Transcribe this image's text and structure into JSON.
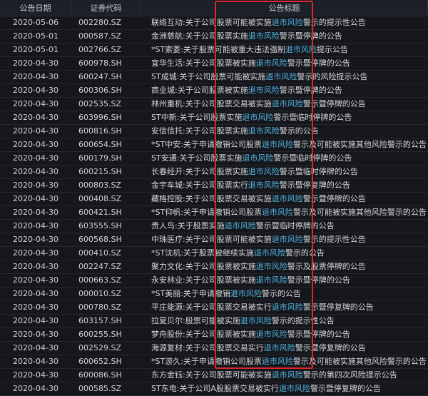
{
  "table": {
    "columns": {
      "date": "公告日期",
      "code": "证券代码",
      "title": "公告标题"
    },
    "rows": [
      {
        "date": "2020-05-06",
        "code": "002280.SZ",
        "pre": "联络互动:关于公司股票可能被实施",
        "hl": "退市风险",
        "post": "警示的提示性公告"
      },
      {
        "date": "2020-05-01",
        "code": "000587.SZ",
        "pre": "金洲慈航:关于公司股票实施",
        "hl": "退市风险",
        "post": "警示暨停牌的公告"
      },
      {
        "date": "2020-05-01",
        "code": "002766.SZ",
        "pre": "*ST索菱:关于股票可能被重大违法强制",
        "hl": "退市风险",
        "post": "提示公告"
      },
      {
        "date": "2020-04-30",
        "code": "600978.SH",
        "pre": "宜华生活:关于公司股票被实施",
        "hl": "退市风险",
        "post": "警示暨停牌的公告"
      },
      {
        "date": "2020-04-30",
        "code": "600247.SH",
        "pre": "ST成城:关于公司股票可能被实施",
        "hl": "退市风险",
        "post": "警示的风险提示公告"
      },
      {
        "date": "2020-04-30",
        "code": "600306.SH",
        "pre": "商业城:关于公司股票被实施",
        "hl": "退市风险",
        "post": "警示暨停牌的公告"
      },
      {
        "date": "2020-04-30",
        "code": "002535.SZ",
        "pre": "林州重机:关于公司股票交易被实施",
        "hl": "退市风险",
        "post": "警示暨停牌的公告"
      },
      {
        "date": "2020-04-30",
        "code": "603996.SH",
        "pre": "ST中新:关于公司股票实施",
        "hl": "退市风险",
        "post": "警示暨临时停牌的公告"
      },
      {
        "date": "2020-04-30",
        "code": "600816.SH",
        "pre": "安信信托:关于公司股票实施",
        "hl": "退市风险",
        "post": "警示的公告"
      },
      {
        "date": "2020-04-30",
        "code": "600654.SH",
        "pre": "*ST中安:关于申请撤销公司股票",
        "hl": "退市风险",
        "post": "警示及可能被实施其他风险警示的公告"
      },
      {
        "date": "2020-04-30",
        "code": "600179.SH",
        "pre": "ST安通:关于公司股票实施",
        "hl": "退市风险",
        "post": "警示暨临时停牌的公告"
      },
      {
        "date": "2020-04-30",
        "code": "600215.SH",
        "pre": "长春经开:关于公司股票实施",
        "hl": "退市风险",
        "post": "警示暨临时停牌的公告"
      },
      {
        "date": "2020-04-30",
        "code": "000803.SZ",
        "pre": "金宇车城:关于公司股票实行",
        "hl": "退市风险",
        "post": "警示暨停复牌的公告"
      },
      {
        "date": "2020-04-30",
        "code": "000408.SZ",
        "pre": "藏格控股:关于公司股票交易被实施",
        "hl": "退市风险",
        "post": "警示暨停牌的公告"
      },
      {
        "date": "2020-04-30",
        "code": "600421.SH",
        "pre": "*ST仰帆:关于申请撤销公司股票",
        "hl": "退市风险",
        "post": "警示及可能被实施其他风险警示的公告"
      },
      {
        "date": "2020-04-30",
        "code": "603555.SH",
        "pre": "贵人鸟:关于股票实施",
        "hl": "退市风险",
        "post": "警示暨临时停牌的公告"
      },
      {
        "date": "2020-04-30",
        "code": "600568.SH",
        "pre": "中珠医疗:关于公司股票可能被实施",
        "hl": "退市风险",
        "post": "警示的提示性公告"
      },
      {
        "date": "2020-04-30",
        "code": "000410.SZ",
        "pre": "*ST沈机:关于股票被继续实施",
        "hl": "退市风险",
        "post": "警示的公告"
      },
      {
        "date": "2020-04-30",
        "code": "002247.SZ",
        "pre": "聚力文化:关于公司股票被实施",
        "hl": "退市风险",
        "post": "警示及股票停牌的公告"
      },
      {
        "date": "2020-04-30",
        "code": "000663.SZ",
        "pre": "永安林业:关于公司股票被实施",
        "hl": "退市风险",
        "post": "警示暨停牌的公告"
      },
      {
        "date": "2020-04-30",
        "code": "000010.SZ",
        "pre": "*ST美丽:关于申请撤销",
        "hl": "退市风险",
        "post": "警示的公告"
      },
      {
        "date": "2020-04-30",
        "code": "000780.SZ",
        "pre": "平庄能源:关于公司股票交易被实行",
        "hl": "退市风险",
        "post": "警示暨停复牌的公告"
      },
      {
        "date": "2020-04-30",
        "code": "603157.SH",
        "pre": "拉夏贝尔:股票可能被实施",
        "hl": "退市风险",
        "post": "警示的提示性公告"
      },
      {
        "date": "2020-04-30",
        "code": "600255.SH",
        "pre": "梦舟股份:关于公司股票被实施",
        "hl": "退市风险",
        "post": "警示暨停牌的公告"
      },
      {
        "date": "2020-04-30",
        "code": "002529.SZ",
        "pre": "海源复材:关于公司股票交易实行",
        "hl": "退市风险",
        "post": "警示暨停复牌的公告"
      },
      {
        "date": "2020-04-30",
        "code": "600652.SH",
        "pre": "*ST游久:关于申请撤销公司股票",
        "hl": "退市风险",
        "post": "警示及可能被实施其他风险警示的公告"
      },
      {
        "date": "2020-04-30",
        "code": "600086.SH",
        "pre": "东方金钰:关于公司股票可能被实施",
        "hl": "退市风险",
        "post": "警示的第四次风险提示公告"
      },
      {
        "date": "2020-04-30",
        "code": "000585.SZ",
        "pre": "ST东电:关于公司A股股票交易被实行",
        "hl": "退市风险",
        "post": "警示暨停复牌的公告"
      }
    ]
  },
  "colors": {
    "highlight_text": "#56b8e6",
    "box_border": "#e0262a",
    "background": "#15171c"
  }
}
